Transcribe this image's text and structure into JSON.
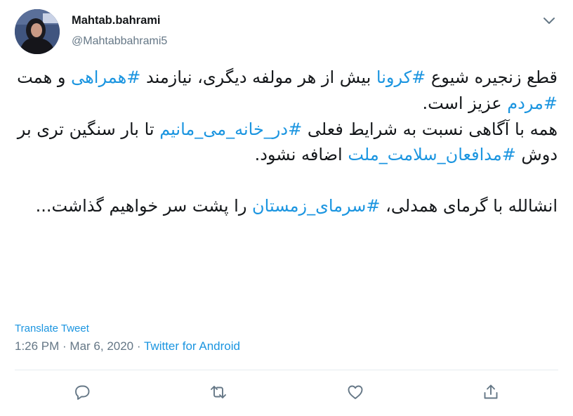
{
  "author": {
    "name": "Mahtab.bahrami",
    "handle": "@Mahtabbahrami5"
  },
  "tweet": {
    "line1_before": "قطع زنجیره شیوع ",
    "tag1": "#کرونا",
    "line1_after": " بیش از هر مولفه دیگری، نیازمند ",
    "tag2": "#همراهی",
    "mid1": " و همت ",
    "tag3": "#مردم",
    "mid2": " عزیز است.",
    "p2_before": "همه با آگاهی نسبت به شرایط فعلی ",
    "tag4": "#در_خانه_می_مانیم",
    "p2_mid": " تا بار سنگین تری بر دوش ",
    "tag5": "#مدافعان_سلامت_ملت",
    "p2_after": " اضافه نشود.",
    "p3_before": "انشالله با گرمای همدلی، ",
    "tag6": "#سرمای_زمستان",
    "p3_after": " را پشت سر خواهیم گذاشت..."
  },
  "translate_label": "Translate Tweet",
  "meta": {
    "time": "1:26 PM",
    "separator1": " · ",
    "date": "Mar 6, 2020",
    "separator2": " · ",
    "source": "Twitter for Android"
  },
  "colors": {
    "link": "#1b95e0",
    "muted": "#657786",
    "text": "#14171a"
  },
  "icons": [
    "caret-down-icon",
    "reply-icon",
    "retweet-icon",
    "like-icon",
    "share-icon"
  ]
}
